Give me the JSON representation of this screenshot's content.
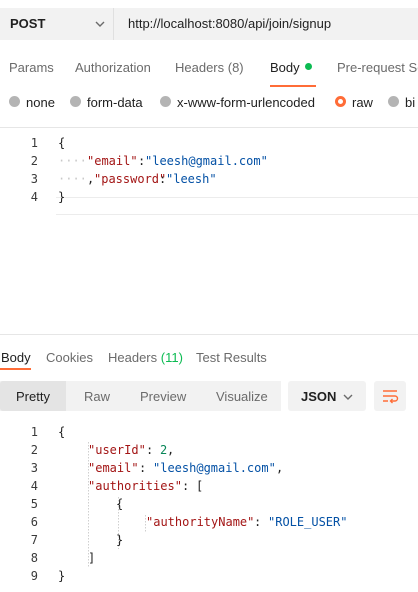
{
  "request": {
    "method": "POST",
    "url": "http://localhost:8080/api/join/signup"
  },
  "request_tabs": [
    {
      "label": "Params"
    },
    {
      "label": "Authorization"
    },
    {
      "label": "Headers (8)"
    },
    {
      "label": "Body"
    },
    {
      "label": "Pre-request Sc"
    }
  ],
  "body_types": [
    {
      "label": "none"
    },
    {
      "label": "form-data"
    },
    {
      "label": "x-www-form-urlencoded"
    },
    {
      "label": "raw"
    },
    {
      "label": "bi"
    }
  ],
  "request_body": {
    "line_numbers": [
      "1",
      "2",
      "3",
      "4"
    ],
    "open_brace": "{",
    "email_key": "\"email\"",
    "email_value": "\"leesh@gmail.com\"",
    "password_key": "\"password\"",
    "password_value": "\"leesh\"",
    "close_brace": "}"
  },
  "response_tabs": [
    {
      "label": "Body"
    },
    {
      "label": "Cookies"
    },
    {
      "label": "Headers"
    },
    {
      "label": "(11)"
    },
    {
      "label": "Test Results"
    }
  ],
  "response_view": {
    "modes": [
      "Pretty",
      "Raw",
      "Preview",
      "Visualize"
    ],
    "format": "JSON"
  },
  "response_body": {
    "line_numbers": [
      "1",
      "2",
      "3",
      "4",
      "5",
      "6",
      "7",
      "8",
      "9"
    ],
    "open_brace": "{",
    "user_id_key": "\"userId\"",
    "user_id_value": "2",
    "email_key": "\"email\"",
    "email_value": "\"leesh@gmail.com\"",
    "authorities_key": "\"authorities\"",
    "open_bracket": "[",
    "inner_open": "{",
    "authority_key": "\"authorityName\"",
    "authority_value": "\"ROLE_USER\"",
    "inner_close": "}",
    "close_bracket": "]",
    "close_brace": "}"
  },
  "colors": {
    "accent": "#ff6c37",
    "status_green": "#0cbb52",
    "json_key": "#a31515",
    "json_string": "#0451a5",
    "json_number": "#098658"
  }
}
